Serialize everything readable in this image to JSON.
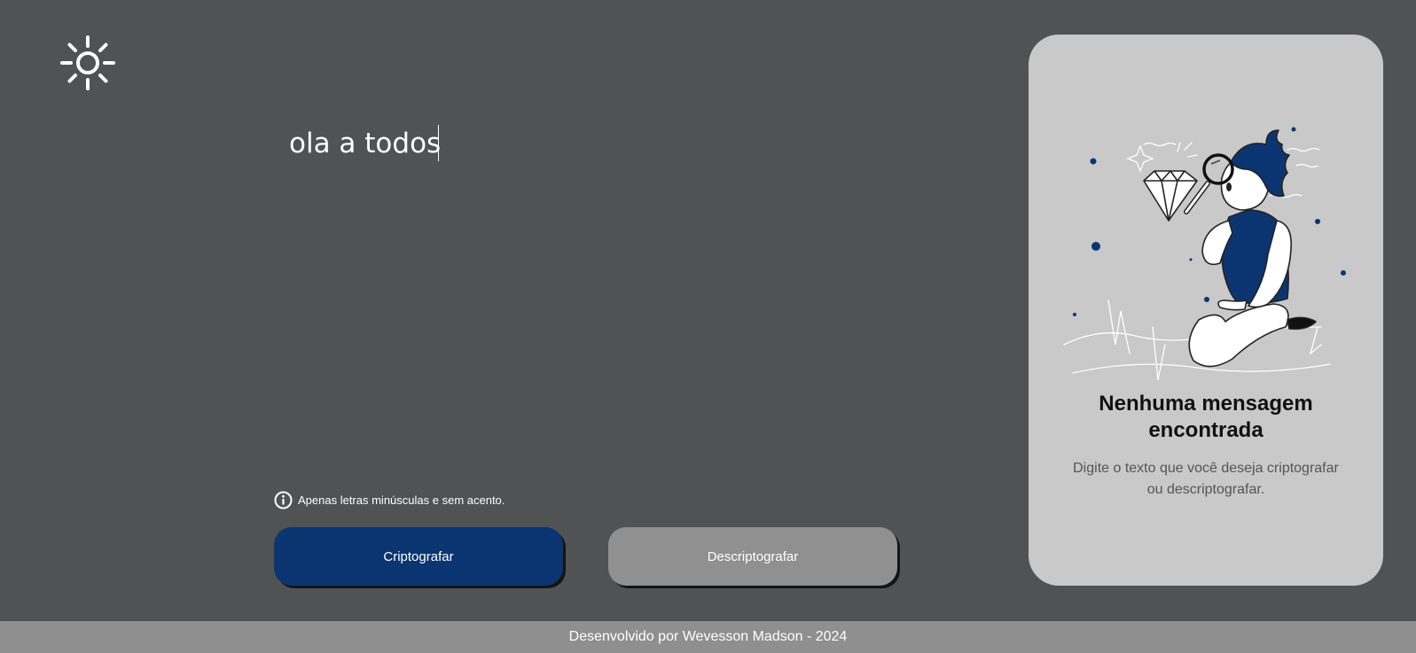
{
  "theme_toggle": {
    "icon": "sun-icon"
  },
  "input": {
    "value": "ola a todos"
  },
  "hint": {
    "icon": "info-icon",
    "text": "Apenas letras minúsculas e sem acento."
  },
  "buttons": {
    "encrypt_label": "Criptografar",
    "decrypt_label": "Descriptografar"
  },
  "output_card": {
    "illustration": "person-with-magnifying-glass-and-diamond-illustration",
    "title": "Nenhuma mensagem encontrada",
    "text": "Digite o texto que você deseja criptografar ou descriptografar."
  },
  "footer": {
    "text": "Desenvolvido por Wevesson Madson - 2024"
  },
  "colors": {
    "background": "#515254",
    "accent": "#0b3570",
    "secondary_button": "#909090",
    "card": "#c9c9c9",
    "footer": "#8f8f8f"
  }
}
